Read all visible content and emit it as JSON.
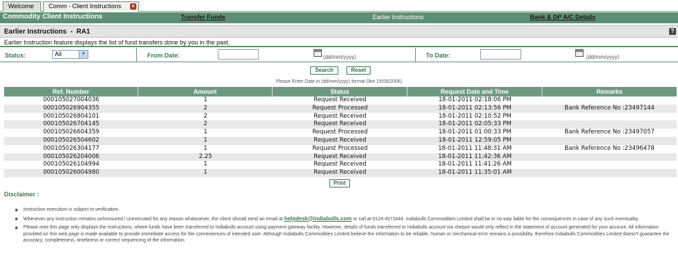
{
  "tabs": [
    {
      "label": "Welcome",
      "active": false
    },
    {
      "label": "Comm - Client Instructions",
      "active": true
    }
  ],
  "menubar": {
    "app_title": "Commodity Client Instructions",
    "transfer_funds": "Transfer Funds",
    "earlier_instructions": "Earlier Instructions",
    "bank_dp": "Bank & DP A/C Details"
  },
  "section": {
    "title": "Earlier Instructions  -  RA1",
    "description": "Earlier Instruction feature displays the list of fund transfers done by you in the past."
  },
  "filters": {
    "status_label": "Status:",
    "status_value": "All",
    "from_label": "From Date:",
    "from_value": "",
    "to_label": "To Date:",
    "to_value": "",
    "date_format": "(dd/mm/yyyy)"
  },
  "buttons": {
    "search": "Search",
    "reset": "Reset",
    "print": "Print"
  },
  "hint": "Please Enter Date in (dd/mm/yyyy) format (like 15/09/2006)",
  "table": {
    "headers": [
      "Ref. Number",
      "Amount",
      "Status",
      "Request Date and Time",
      "Remarks"
    ],
    "rows": [
      [
        "000105027004036",
        "1",
        "Request Received",
        "18-01-2011 02:18:06 PM",
        ""
      ],
      [
        "000105026904355",
        "2",
        "Request Processed",
        "18-01-2011 02:13:56 PM",
        "Bank Reference No :23497144"
      ],
      [
        "000105026804101",
        "2",
        "Request Received",
        "18-01-2011 02:10:52 PM",
        ""
      ],
      [
        "000105026704145",
        "2",
        "Request Received",
        "18-01-2011 02:05:33 PM",
        ""
      ],
      [
        "000105026604359",
        "1",
        "Request Processed",
        "18-01-2011 01:00:33 PM",
        "Bank Reference No :23497057"
      ],
      [
        "000105026504602",
        "1",
        "Request Received",
        "18-01-2011 12:59:05 PM",
        ""
      ],
      [
        "000105026304177",
        "1",
        "Request Processed",
        "18-01-2011 11:48:31 AM",
        "Bank Reference No :23496478"
      ],
      [
        "000105026204006",
        "2.25",
        "Request Received",
        "18-01-2011 11:42:36 AM",
        ""
      ],
      [
        "000105026104994",
        "1",
        "Request Received",
        "18-01-2011 11:41:26 AM",
        ""
      ],
      [
        "000105026004980",
        "1",
        "Request Received",
        "18-01-2011 11:35:01 AM",
        ""
      ]
    ]
  },
  "disclaimer": {
    "label": "Disclaimer :",
    "item1": "Instruction execution is subject to verification.",
    "item2_pre": "Whenever any instruction remains unhonoured / unexecuted for any reason whatsoever, the client should send an email at ",
    "item2_email": "helpdesk@indiabulls.com",
    "item2_post": " or call at 0124-4572444. Indiabulls Commodities Limited shall be in no way liable for the consequences in case of any such eventuality.",
    "item3": "Please note this page only displays the instructions, where funds have been transferred to Indiabulls account using payment gateway facility. However, details of funds transferred to Indiabulls account via cheque would only reflect in the statement of account generated for your account. All information provided on this web page is made available to provide immediate access for the conveniences of intended user. Although Indiabulls Commodities Limited believe the information to be reliable, human or mechanical error remains a possibility, therefore Indiabulls Commodities Limited doesn't guarantee the accuracy, completeness, timeliness or correct sequencing of the information."
  },
  "colors": {
    "header_green": "#5e8f74",
    "table_header": "#6d9a7f",
    "label_green": "#3a7a54"
  }
}
